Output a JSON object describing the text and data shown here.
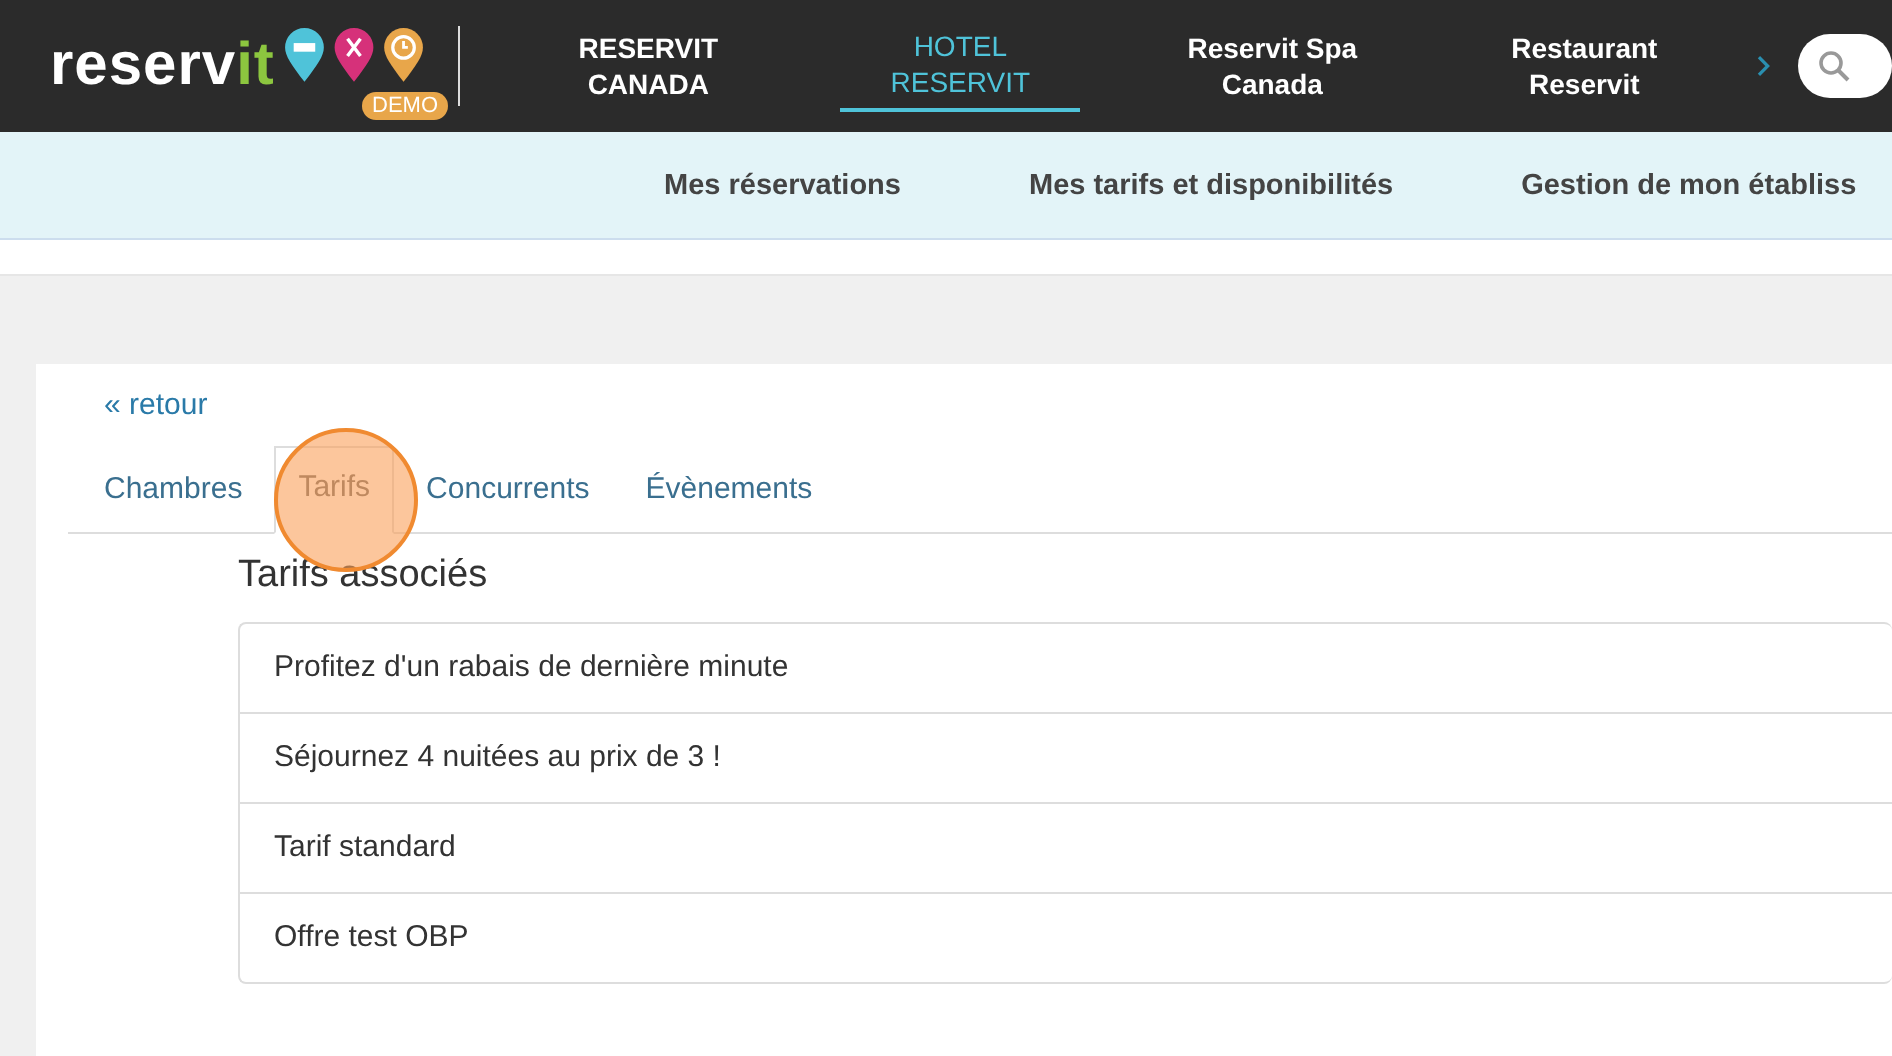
{
  "header": {
    "logo": {
      "parts": [
        "reserv",
        "it"
      ]
    },
    "badge": "DEMO",
    "nav": [
      {
        "label": "RESERVIT CANADA",
        "selected": false
      },
      {
        "label": "HOTEL RESERVIT",
        "selected": true
      },
      {
        "label": "Reservit Spa Canada",
        "selected": false
      },
      {
        "label": "Restaurant Reservit",
        "selected": false
      }
    ]
  },
  "subnav": {
    "items": [
      "Mes réservations",
      "Mes tarifs et disponibilités",
      "Gestion de mon établiss"
    ]
  },
  "back_link": "« retour",
  "tabs": [
    {
      "label": "Chambres",
      "selected": false
    },
    {
      "label": "Tarifs",
      "selected": true
    },
    {
      "label": "Concurrents",
      "selected": false
    },
    {
      "label": "Évènements",
      "selected": false
    }
  ],
  "section": {
    "title": "Tarifs associés",
    "items": [
      "Profitez d'un rabais de dernière minute",
      "Séjournez 4 nuitées au prix de 3 !",
      "Tarif standard",
      "Offre test OBP"
    ]
  }
}
